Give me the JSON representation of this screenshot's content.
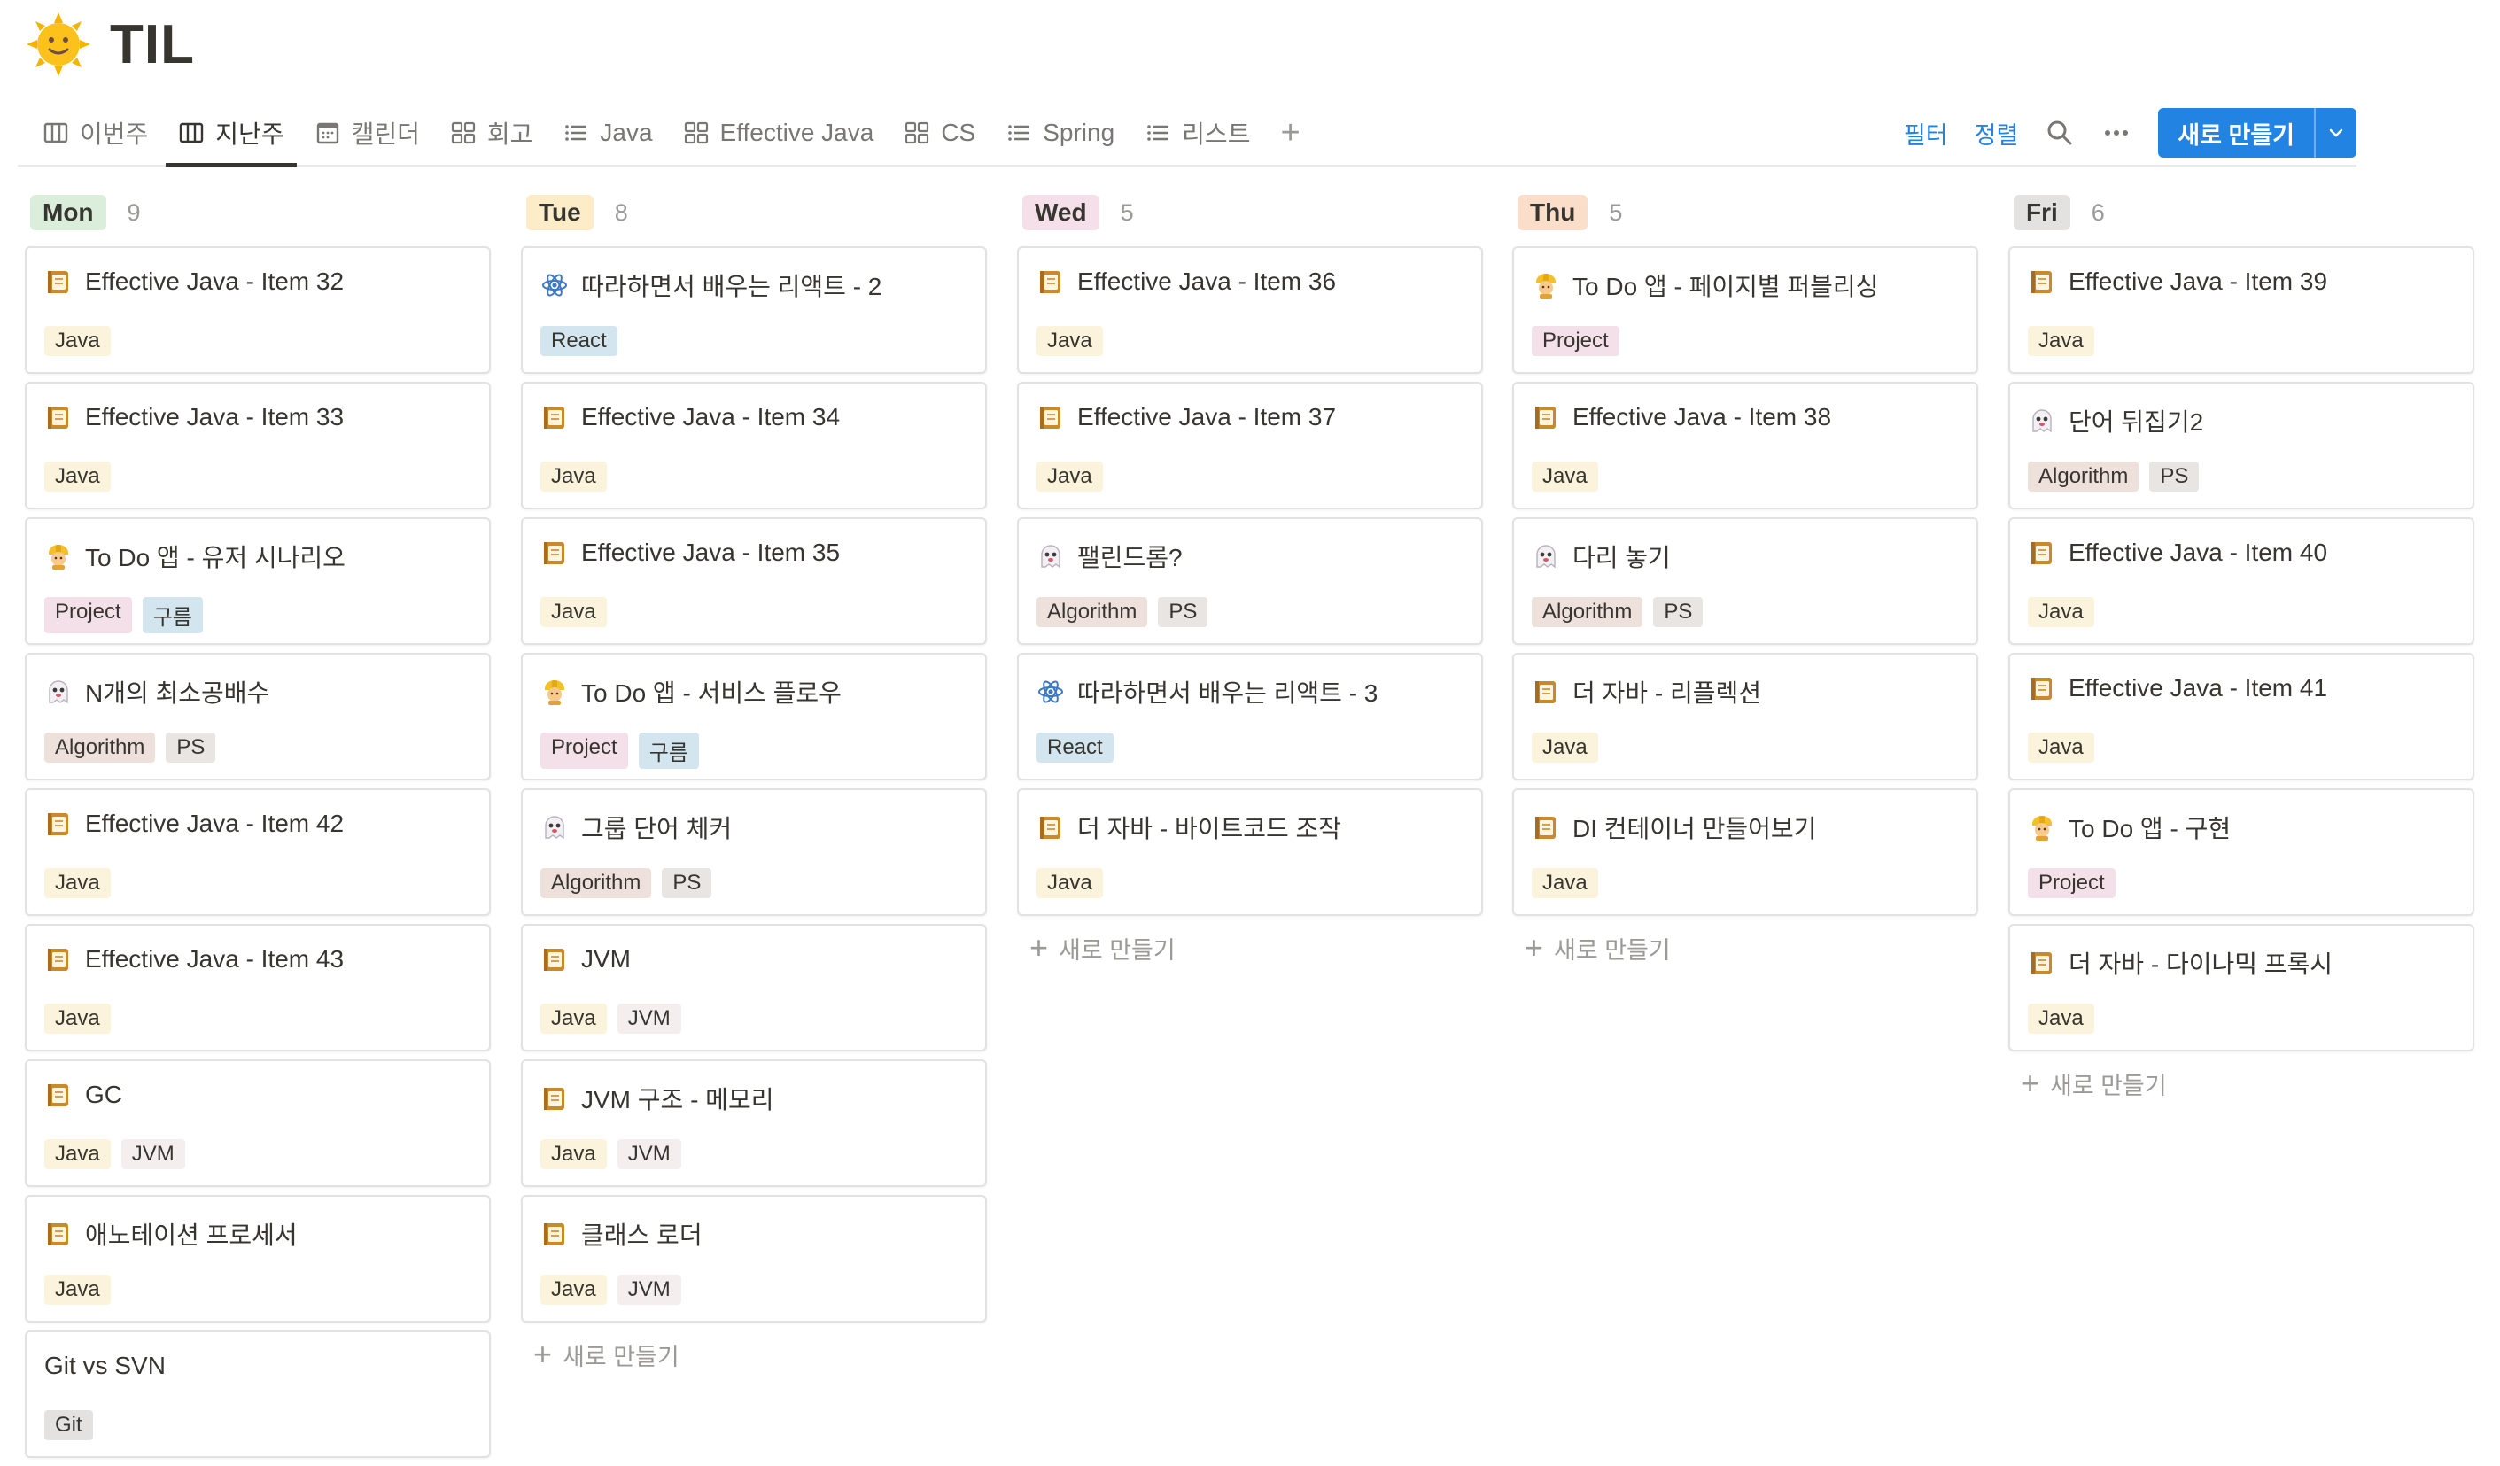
{
  "page": {
    "title": "TIL",
    "icon": "sun-emoji-icon"
  },
  "tabs": [
    {
      "label": "이번주",
      "icon": "board-icon",
      "active": false
    },
    {
      "label": "지난주",
      "icon": "board-icon",
      "active": true
    },
    {
      "label": "캘린더",
      "icon": "calendar-icon",
      "active": false
    },
    {
      "label": "회고",
      "icon": "gallery-icon",
      "active": false
    },
    {
      "label": "Java",
      "icon": "list-icon",
      "active": false
    },
    {
      "label": "Effective Java",
      "icon": "gallery-icon",
      "active": false
    },
    {
      "label": "CS",
      "icon": "gallery-icon",
      "active": false
    },
    {
      "label": "Spring",
      "icon": "list-icon",
      "active": false
    },
    {
      "label": "리스트",
      "icon": "list-icon",
      "active": false
    }
  ],
  "toolbar": {
    "filter_label": "필터",
    "sort_label": "정렬",
    "new_label": "새로 만들기"
  },
  "new_item_label": "새로 만들기",
  "tag_colors": {
    "Java": "#fbf3db",
    "JVM": "#f4eeee",
    "Project": "#f4e0e9",
    "구름": "#d3e5ef",
    "Algorithm": "#eee0da",
    "PS": "#e9e5e3",
    "React": "#d3e5ef",
    "Git": "#e3e2e0"
  },
  "columns": [
    {
      "day": "Mon",
      "count": "9",
      "pill_color": "#dbeddb",
      "show_new": false,
      "cards": [
        {
          "title": "Effective Java - Item 32",
          "icon": "notebook-icon",
          "tags": [
            "Java"
          ]
        },
        {
          "title": "Effective Java - Item 33",
          "icon": "notebook-icon",
          "tags": [
            "Java"
          ]
        },
        {
          "title": "To Do 앱 - 유저 시나리오",
          "icon": "construction-worker-icon",
          "tags": [
            "Project",
            "구름"
          ]
        },
        {
          "title": "N개의 최소공배수",
          "icon": "ghost-icon",
          "tags": [
            "Algorithm",
            "PS"
          ]
        },
        {
          "title": "Effective Java - Item 42",
          "icon": "notebook-icon",
          "tags": [
            "Java"
          ]
        },
        {
          "title": "Effective Java - Item 43",
          "icon": "notebook-icon",
          "tags": [
            "Java"
          ]
        },
        {
          "title": "GC",
          "icon": "notebook-icon",
          "tags": [
            "Java",
            "JVM"
          ]
        },
        {
          "title": "애노테이션 프로세서",
          "icon": "notebook-icon",
          "tags": [
            "Java"
          ]
        },
        {
          "title": "Git vs SVN",
          "icon": "",
          "tags": [
            "Git"
          ]
        }
      ]
    },
    {
      "day": "Tue",
      "count": "8",
      "pill_color": "#fdecc8",
      "show_new": true,
      "cards": [
        {
          "title": "따라하면서 배우는 리액트 - 2",
          "icon": "react-atom-icon",
          "tags": [
            "React"
          ]
        },
        {
          "title": "Effective Java - Item 34",
          "icon": "notebook-icon",
          "tags": [
            "Java"
          ]
        },
        {
          "title": "Effective Java - Item 35",
          "icon": "notebook-icon",
          "tags": [
            "Java"
          ]
        },
        {
          "title": "To Do 앱 - 서비스 플로우",
          "icon": "construction-worker-icon",
          "tags": [
            "Project",
            "구름"
          ]
        },
        {
          "title": "그룹 단어 체커",
          "icon": "ghost-icon",
          "tags": [
            "Algorithm",
            "PS"
          ]
        },
        {
          "title": "JVM",
          "icon": "notebook-icon",
          "tags": [
            "Java",
            "JVM"
          ]
        },
        {
          "title": "JVM 구조 - 메모리",
          "icon": "notebook-icon",
          "tags": [
            "Java",
            "JVM"
          ]
        },
        {
          "title": "클래스 로더",
          "icon": "notebook-icon",
          "tags": [
            "Java",
            "JVM"
          ]
        }
      ]
    },
    {
      "day": "Wed",
      "count": "5",
      "pill_color": "#f5e0e9",
      "show_new": true,
      "cards": [
        {
          "title": "Effective Java - Item 36",
          "icon": "notebook-icon",
          "tags": [
            "Java"
          ]
        },
        {
          "title": "Effective Java - Item 37",
          "icon": "notebook-icon",
          "tags": [
            "Java"
          ]
        },
        {
          "title": "팰린드롬?",
          "icon": "ghost-icon",
          "tags": [
            "Algorithm",
            "PS"
          ]
        },
        {
          "title": "따라하면서 배우는 리액트 - 3",
          "icon": "react-atom-icon",
          "tags": [
            "React"
          ]
        },
        {
          "title": "더 자바 - 바이트코드 조작",
          "icon": "notebook-icon",
          "tags": [
            "Java"
          ]
        }
      ]
    },
    {
      "day": "Thu",
      "count": "5",
      "pill_color": "#fadec9",
      "show_new": true,
      "cards": [
        {
          "title": "To Do 앱 - 페이지별 퍼블리싱",
          "icon": "construction-worker-icon",
          "tags": [
            "Project"
          ]
        },
        {
          "title": "Effective Java - Item 38",
          "icon": "notebook-icon",
          "tags": [
            "Java"
          ]
        },
        {
          "title": "다리 놓기",
          "icon": "ghost-icon",
          "tags": [
            "Algorithm",
            "PS"
          ]
        },
        {
          "title": "더 자바 - 리플렉션",
          "icon": "notebook-icon",
          "tags": [
            "Java"
          ]
        },
        {
          "title": "DI 컨테이너 만들어보기",
          "icon": "notebook-icon",
          "tags": [
            "Java"
          ]
        }
      ]
    },
    {
      "day": "Fri",
      "count": "6",
      "pill_color": "#e3e2e0",
      "show_new": true,
      "cards": [
        {
          "title": "Effective Java - Item 39",
          "icon": "notebook-icon",
          "tags": [
            "Java"
          ]
        },
        {
          "title": "단어 뒤집기2",
          "icon": "ghost-icon",
          "tags": [
            "Algorithm",
            "PS"
          ]
        },
        {
          "title": "Effective Java - Item 40",
          "icon": "notebook-icon",
          "tags": [
            "Java"
          ]
        },
        {
          "title": "Effective Java - Item 41",
          "icon": "notebook-icon",
          "tags": [
            "Java"
          ]
        },
        {
          "title": "To Do 앱 - 구현",
          "icon": "construction-worker-icon",
          "tags": [
            "Project"
          ]
        },
        {
          "title": "더 자바 - 다이나믹 프록시",
          "icon": "notebook-icon",
          "tags": [
            "Java"
          ]
        }
      ]
    }
  ]
}
